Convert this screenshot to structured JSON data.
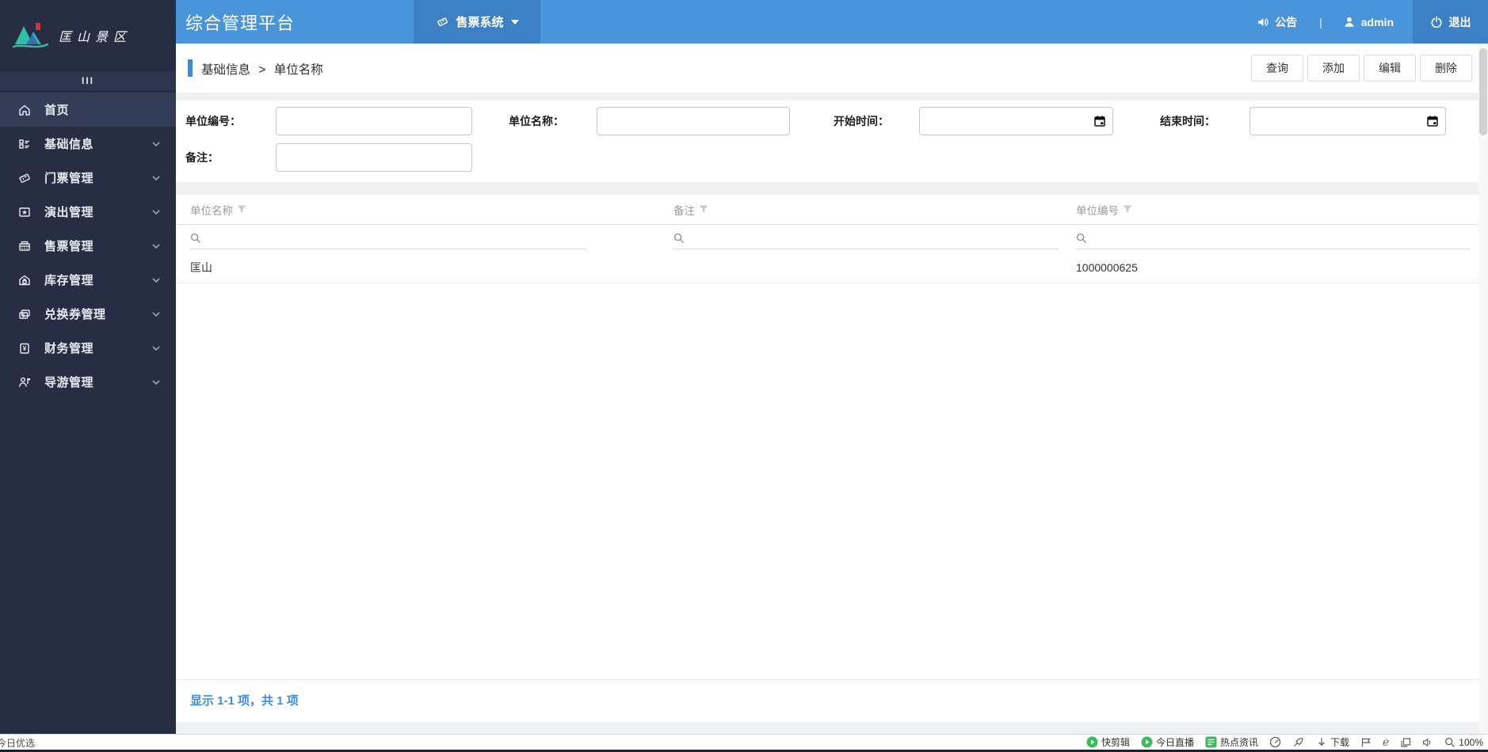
{
  "app": {
    "title": "综合管理平台"
  },
  "header": {
    "system_tab": {
      "label": "售票系统"
    },
    "announcement": "公告",
    "divider": "|",
    "username": "admin",
    "logout": "退出"
  },
  "sidebar": {
    "logo_text": "匡山景区",
    "collapse_label": "III",
    "items": [
      {
        "label": "首页",
        "icon": "home-icon",
        "active": true
      },
      {
        "label": "基础信息",
        "icon": "list-icon",
        "active": false
      },
      {
        "label": "门票管理",
        "icon": "ticket-icon",
        "active": false
      },
      {
        "label": "演出管理",
        "icon": "stage-icon",
        "active": false
      },
      {
        "label": "售票管理",
        "icon": "pos-icon",
        "active": false
      },
      {
        "label": "库存管理",
        "icon": "warehouse-icon",
        "active": false
      },
      {
        "label": "兑换券管理",
        "icon": "voucher-icon",
        "active": false
      },
      {
        "label": "财务管理",
        "icon": "finance-icon",
        "active": false
      },
      {
        "label": "导游管理",
        "icon": "guide-icon",
        "active": false
      }
    ]
  },
  "breadcrumb": {
    "section": "基础信息",
    "separator": ">",
    "page": "单位名称"
  },
  "toolbar": {
    "query": "查询",
    "add": "添加",
    "edit": "编辑",
    "delete": "删除"
  },
  "filter_form": {
    "unit_code_label": "单位编号：",
    "unit_name_label": "单位名称：",
    "start_time_label": "开始时间：",
    "end_time_label": "结束时间：",
    "remark_label": "备注："
  },
  "table": {
    "columns": [
      {
        "label": "单位名称"
      },
      {
        "label": "备注"
      },
      {
        "label": "单位编号"
      }
    ],
    "rows": [
      {
        "unit_name": "匡山",
        "remark": "",
        "unit_code": "1000000625"
      }
    ],
    "summary": "显示 1-1 项，共 1 项"
  },
  "statusbar": {
    "left_text": "今日优选",
    "quick_clip": "快剪辑",
    "today_live": "今日直播",
    "hot_news": "热点资讯",
    "download": "下载",
    "ie_label": "e",
    "zoom_level": "100%"
  },
  "colors": {
    "header_blue": "#4a94d9",
    "header_dark_blue": "#3d80c4",
    "sidebar_bg": "#272e44",
    "sidebar_active": "#333c56",
    "accent_blue": "#3d8bd4",
    "link_blue": "#3e8ede",
    "badge_green": "#3bbd5e",
    "seal_red": "#d9342b",
    "logo_teal": "#2fbfa8"
  }
}
